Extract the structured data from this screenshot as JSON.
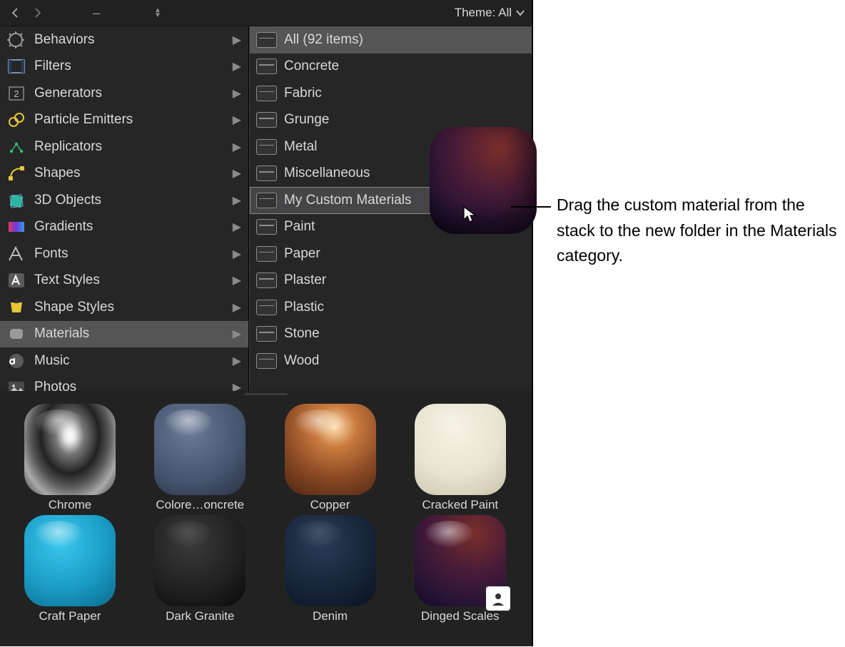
{
  "toolbar": {
    "theme_label": "Theme: All"
  },
  "categories": [
    {
      "label": "Behaviors"
    },
    {
      "label": "Filters"
    },
    {
      "label": "Generators"
    },
    {
      "label": "Particle Emitters"
    },
    {
      "label": "Replicators"
    },
    {
      "label": "Shapes"
    },
    {
      "label": "3D Objects"
    },
    {
      "label": "Gradients"
    },
    {
      "label": "Fonts"
    },
    {
      "label": "Text Styles"
    },
    {
      "label": "Shape Styles"
    },
    {
      "label": "Materials"
    },
    {
      "label": "Music"
    },
    {
      "label": "Photos"
    }
  ],
  "categories_selected_index": 11,
  "folders": [
    {
      "label": "All (92 items)"
    },
    {
      "label": "Concrete"
    },
    {
      "label": "Fabric"
    },
    {
      "label": "Grunge"
    },
    {
      "label": "Metal"
    },
    {
      "label": "Miscellaneous"
    },
    {
      "label": "My Custom Materials"
    },
    {
      "label": "Paint"
    },
    {
      "label": "Paper"
    },
    {
      "label": "Plaster"
    },
    {
      "label": "Plastic"
    },
    {
      "label": "Stone"
    },
    {
      "label": "Wood"
    }
  ],
  "folders_selected_index": 0,
  "folders_drop_target_index": 6,
  "dragged_material": "Dinged Scales",
  "thumbnails": [
    {
      "label": "Chrome",
      "style": "mat-chrome",
      "user": false
    },
    {
      "label": "Colore…oncrete",
      "style": "mat-concrete",
      "user": false
    },
    {
      "label": "Copper",
      "style": "mat-copper",
      "user": false
    },
    {
      "label": "Cracked Paint",
      "style": "mat-cracked",
      "user": false
    },
    {
      "label": "Craft Paper",
      "style": "mat-craft",
      "user": false
    },
    {
      "label": "Dark Granite",
      "style": "mat-granite",
      "user": false
    },
    {
      "label": "Denim",
      "style": "mat-denim",
      "user": false
    },
    {
      "label": "Dinged Scales",
      "style": "mat-scales",
      "user": true
    }
  ],
  "annotation": {
    "text": "Drag the custom material from the stack to the new folder in the Materials category."
  }
}
